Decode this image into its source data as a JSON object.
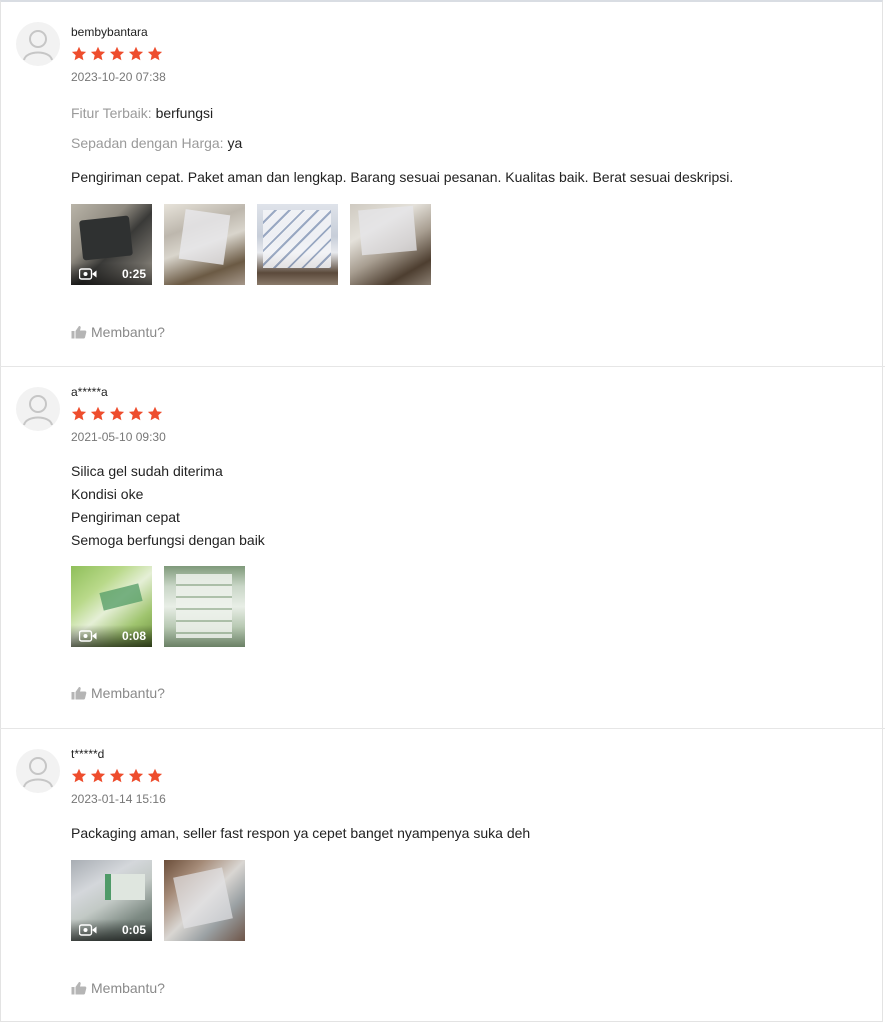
{
  "reviews": [
    {
      "username": "bembybantara",
      "rating": 5,
      "date": "2023-10-20 07:38",
      "attributes": [
        {
          "label": "Fitur Terbaik:",
          "value": "berfungsi"
        },
        {
          "label": "Sepadan dengan Harga:",
          "value": "ya"
        }
      ],
      "text_lines": [
        "Pengiriman cepat. Paket aman dan lengkap. Barang sesuai pesanan. Kualitas baik. Berat sesuai deskripsi."
      ],
      "media": [
        {
          "kind": "video",
          "duration": "0:25",
          "tone": "scale"
        },
        {
          "kind": "image",
          "tone": "silver"
        },
        {
          "kind": "image",
          "tone": "bluewhite"
        },
        {
          "kind": "image",
          "tone": "silverdark"
        }
      ],
      "helpful_label": "Membantu?"
    },
    {
      "username": "a*****a",
      "rating": 5,
      "date": "2021-05-10 09:30",
      "attributes": [],
      "text_lines": [
        "Silica gel sudah diterima",
        "Kondisi oke",
        "Pengiriman cepat",
        "Semoga berfungsi dengan baik"
      ],
      "media": [
        {
          "kind": "video",
          "duration": "0:08",
          "tone": "green"
        },
        {
          "kind": "image",
          "tone": "greenwhite"
        }
      ],
      "helpful_label": "Membantu?"
    },
    {
      "username": "t*****d",
      "rating": 5,
      "date": "2023-01-14 15:16",
      "attributes": [],
      "text_lines": [
        "Packaging aman, seller fast respon ya cepet banget nyampenya suka deh"
      ],
      "media": [
        {
          "kind": "video",
          "duration": "0:05",
          "tone": "grayblue"
        },
        {
          "kind": "image",
          "tone": "silverbrown"
        }
      ],
      "helpful_label": "Membantu?"
    }
  ],
  "colors": {
    "star": "#ee4d2d",
    "muted": "#9a9a9a",
    "divider": "#e6e6e6"
  }
}
